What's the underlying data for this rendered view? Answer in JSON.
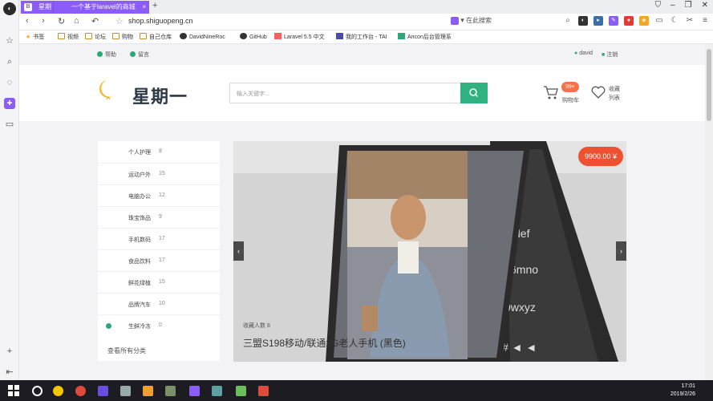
{
  "browser": {
    "tabs": [
      {
        "label": "星期"
      },
      {
        "label": "一个基于laravel的商城"
      }
    ],
    "url": "shop.shiguopeng.cn",
    "search_label": "在此搜索",
    "bookmarks": [
      {
        "label": "书签"
      },
      {
        "label": "视频"
      },
      {
        "label": "论坛"
      },
      {
        "label": "购物"
      },
      {
        "label": "自己仓库"
      },
      {
        "label": "DavidNineRoc"
      },
      {
        "label": "GitHub"
      },
      {
        "label": "Laravel 5.5 中文"
      },
      {
        "label": "我的工作台 - TAI"
      },
      {
        "label": "Ancon后台管理系"
      }
    ]
  },
  "site": {
    "top_left": [
      {
        "label": "帮助"
      },
      {
        "label": "留言"
      }
    ],
    "top_right": [
      {
        "label": "david"
      },
      {
        "label": "注销"
      }
    ],
    "brand": "星期一",
    "search_placeholder": "输入关键字...",
    "cart": {
      "count": "99+",
      "label": "购物车"
    },
    "favorites_label": "收藏\n列表"
  },
  "categories": [
    {
      "name": "个人护理",
      "count": "8"
    },
    {
      "name": "运动户外",
      "count": "15"
    },
    {
      "name": "电脑办公",
      "count": "12"
    },
    {
      "name": "珠宝饰品",
      "count": "9"
    },
    {
      "name": "手机数码",
      "count": "17"
    },
    {
      "name": "食品饮料",
      "count": "17"
    },
    {
      "name": "鲜花绿植",
      "count": "15"
    },
    {
      "name": "品牌汽车",
      "count": "10"
    },
    {
      "name": "生鲜冷冻",
      "count": "0"
    }
  ],
  "categories_all": "查看所有分类",
  "banner": {
    "price": "9900.00",
    "collect": "收藏人数 8",
    "title": "三盟S198移动/联通2G老人手机 (黑色)"
  },
  "taskbar": {
    "time": "17:01",
    "date": "2019/2/26"
  }
}
